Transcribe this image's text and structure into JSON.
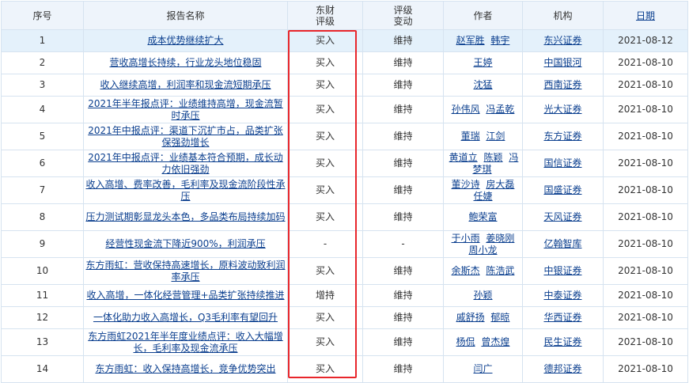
{
  "headers": {
    "index": "序号",
    "title": "报告名称",
    "rating_line1": "东财",
    "rating_line2": "评级",
    "change_line1": "评级",
    "change_line2": "变动",
    "authors": "作者",
    "org": "机构",
    "date": "日期"
  },
  "rows": [
    {
      "index": "1",
      "title": "成本优势继续扩大",
      "rating": "买入",
      "change": "维持",
      "authors": [
        "赵军胜",
        "韩宇"
      ],
      "org": "东兴证券",
      "date": "2021-08-12"
    },
    {
      "index": "2",
      "title": "营收高增长持续，行业龙头地位稳固",
      "rating": "买入",
      "change": "维持",
      "authors": [
        "王婷"
      ],
      "org": "中国银河",
      "date": "2021-08-10"
    },
    {
      "index": "3",
      "title": "收入继续高增，利润率和现金流短期承压",
      "rating": "买入",
      "change": "维持",
      "authors": [
        "沈猛"
      ],
      "org": "西南证券",
      "date": "2021-08-10"
    },
    {
      "index": "4",
      "title": "2021年半年报点评：业绩维持高增，现金流暂时承压",
      "rating": "买入",
      "change": "维持",
      "authors": [
        "孙伟风",
        "冯孟乾"
      ],
      "org": "光大证券",
      "date": "2021-08-10"
    },
    {
      "index": "5",
      "title": "2021年中报点评：渠道下沉扩市占，品类扩张保强劲增长",
      "rating": "买入",
      "change": "维持",
      "authors": [
        "董瑞",
        "江剑"
      ],
      "org": "东方证券",
      "date": "2021-08-10"
    },
    {
      "index": "6",
      "title": "2021年中报点评：业绩基本符合预期，成长动力依旧强劲",
      "rating": "买入",
      "change": "维持",
      "authors": [
        "黄道立",
        "陈颖",
        "冯梦琪"
      ],
      "org": "国信证券",
      "date": "2021-08-10"
    },
    {
      "index": "7",
      "title": "收入高增、费率改善，毛利率及现金流阶段性承压",
      "rating": "买入",
      "change": "维持",
      "authors": [
        "董沙诗",
        "房大磊",
        "任婕"
      ],
      "org": "国盛证券",
      "date": "2021-08-10"
    },
    {
      "index": "8",
      "title": "压力测试期彰显龙头本色，多品类布局持续加码",
      "rating": "买入",
      "change": "维持",
      "authors": [
        "鲍荣富"
      ],
      "org": "天风证券",
      "date": "2021-08-10"
    },
    {
      "index": "9",
      "title": "经营性现金流下降近900%，利润承压",
      "rating": "-",
      "change": "-",
      "authors": [
        "于小雨",
        "姜晓刚",
        "周小龙"
      ],
      "org": "亿翰智库",
      "date": "2021-08-10"
    },
    {
      "index": "10",
      "title": "东方雨虹：营收保持高速增长，原料波动致利润率承压",
      "rating": "买入",
      "change": "维持",
      "authors": [
        "余斯杰",
        "陈浩武"
      ],
      "org": "中银证券",
      "date": "2021-08-10"
    },
    {
      "index": "11",
      "title": "收入高增，一体化经营管理+品类扩张持续推进",
      "rating": "增持",
      "change": "维持",
      "authors": [
        "孙颖"
      ],
      "org": "中泰证券",
      "date": "2021-08-10"
    },
    {
      "index": "12",
      "title": "一体化助力收入高增长，Q3毛利率有望回升",
      "rating": "买入",
      "change": "维持",
      "authors": [
        "戚舒扬",
        "郁晾"
      ],
      "org": "华西证券",
      "date": "2021-08-10"
    },
    {
      "index": "13",
      "title": "东方雨虹2021年半年度业绩点评：收入大幅增长，毛利率及现金流承压",
      "rating": "买入",
      "change": "维持",
      "authors": [
        "杨侃",
        "曾杰煌"
      ],
      "org": "民生证券",
      "date": "2021-08-10"
    },
    {
      "index": "14",
      "title": "东方雨虹：收入保持高增长，竞争优势突出",
      "rating": "买入",
      "change": "维持",
      "authors": [
        "闫广"
      ],
      "org": "德邦证券",
      "date": "2021-08-10"
    }
  ],
  "colors": {
    "link": "#0b3f8f",
    "header_bg": "#eef4fb",
    "highlight_row": "#e4f1fb",
    "border": "#d6e3f0",
    "annotation_box": "#e8262b"
  }
}
